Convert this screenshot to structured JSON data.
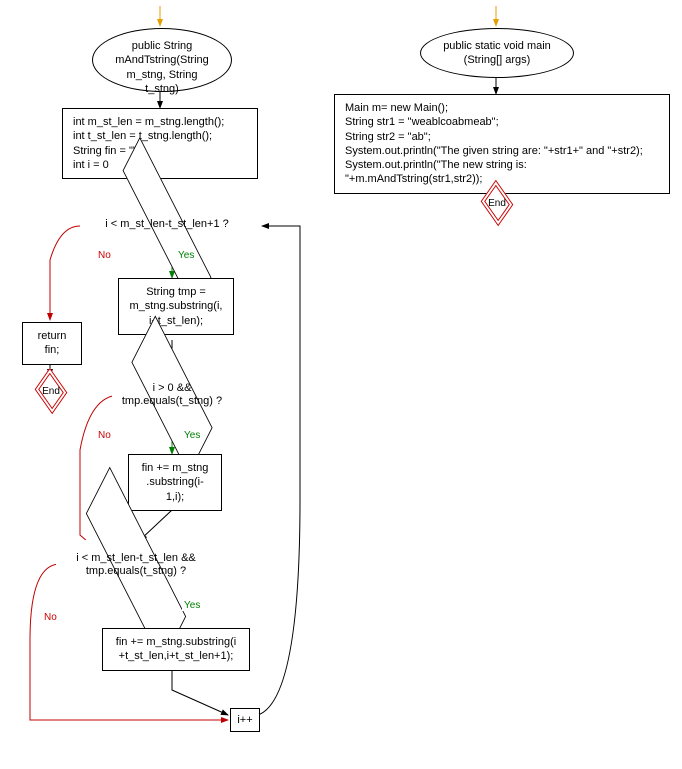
{
  "left_flow": {
    "method_sig": "public String mAndTstring(String m_stng, String t_stng)",
    "init_block": "int m_st_len = m_stng.length();\nint t_st_len = t_stng.length();\nString fin = \"\";\nint i = 0",
    "cond1": "i < m_st_len-t_st_len+1 ?",
    "return": "return fin;",
    "tmp_block": "String tmp = m_stng.substring(i, i+t_st_len);",
    "cond2": "i > 0 && tmp.equals(t_stng) ?",
    "append1": "fin += m_stng .substring(i-1,i);",
    "cond3": "i < m_st_len-t_st_len && tmp.equals(t_stng) ?",
    "append2": "fin += m_stng.substring(i +t_st_len,i+t_st_len+1);",
    "increment": "i++",
    "end": "End"
  },
  "right_flow": {
    "method_sig": "public static void main (String[] args)",
    "body": "Main m= new Main();\nString str1 = \"weablcoabmeab\";\nString str2 = \"ab\";\nSystem.out.println(\"The given string are: \"+str1+\"  and  \"+str2);\nSystem.out.println(\"The new string is: \"+m.mAndTstring(str1,str2));",
    "end": "End"
  },
  "labels": {
    "yes": "Yes",
    "no": "No"
  }
}
